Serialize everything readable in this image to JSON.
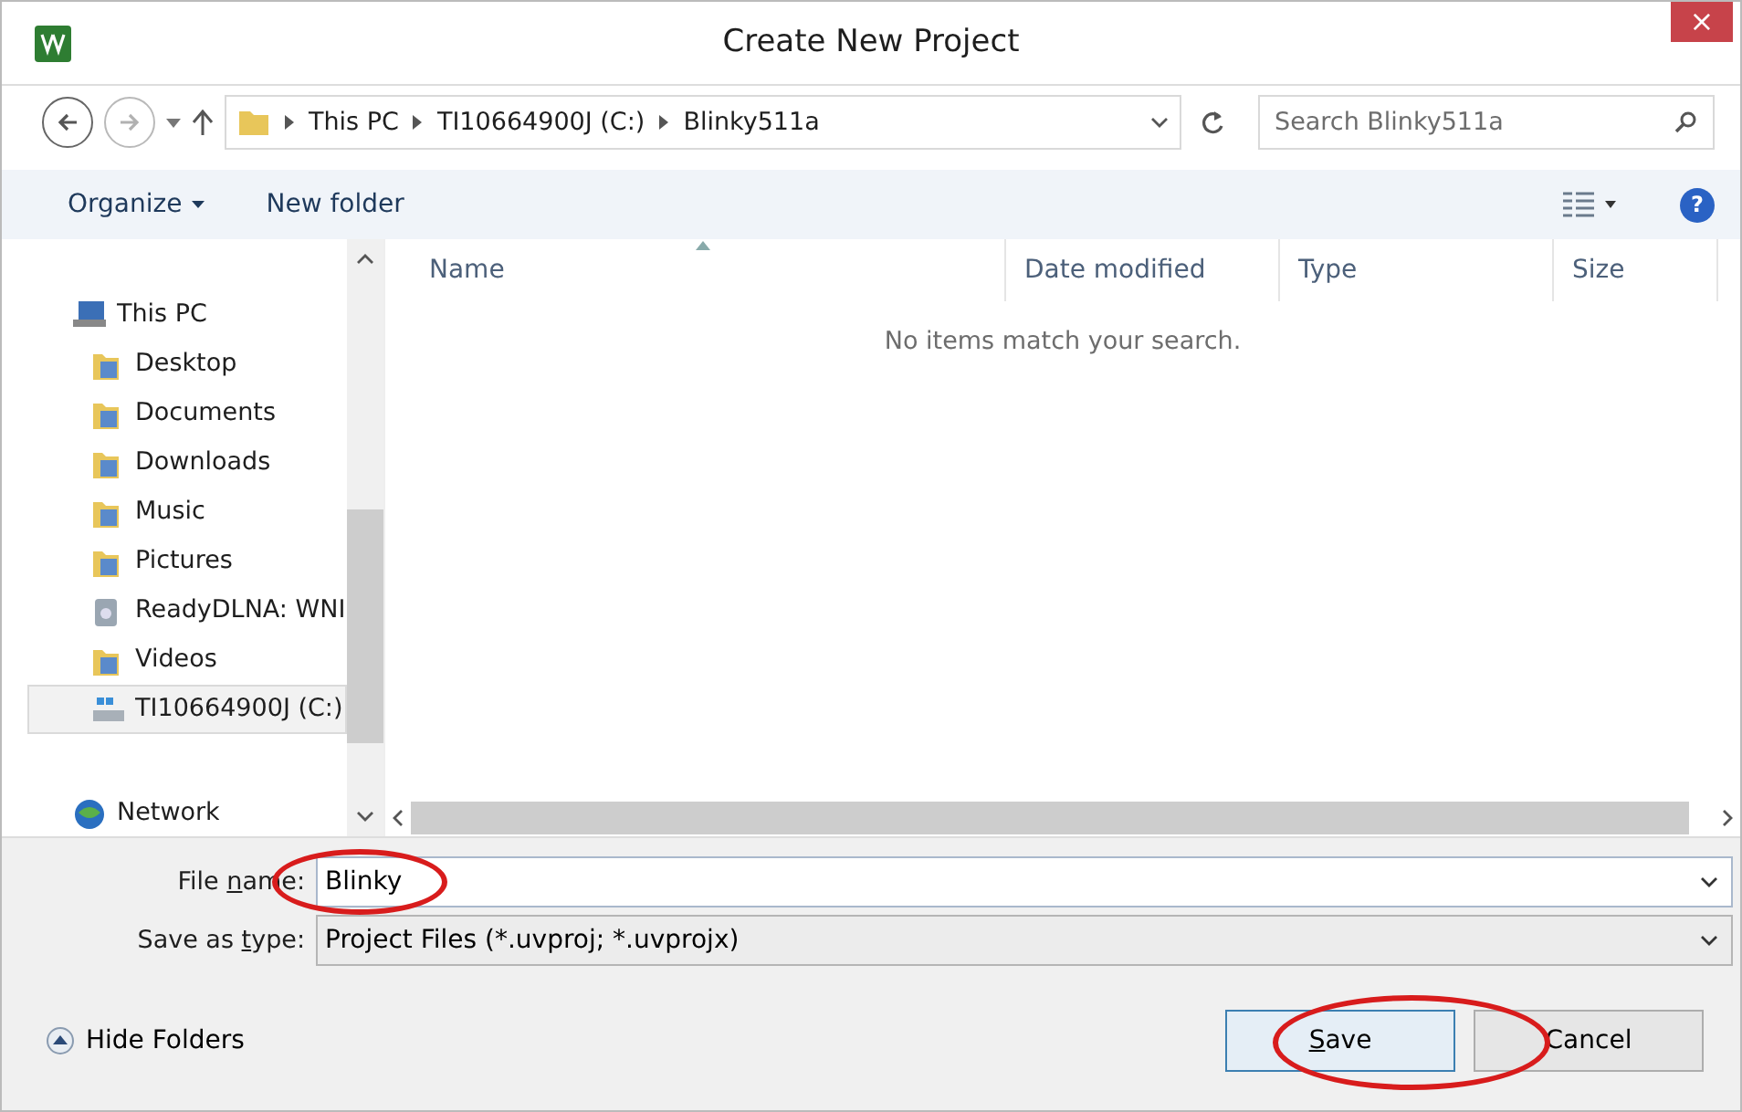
{
  "window": {
    "title": "Create New Project",
    "close": "×"
  },
  "address_bar": {
    "path": [
      "This PC",
      "TI10664900J (C:)",
      "Blinky511a"
    ],
    "search_placeholder": "Search Blinky511a"
  },
  "toolbar": {
    "organize": "Organize",
    "new_folder": "New folder",
    "help": "?"
  },
  "sidebar": {
    "items": [
      {
        "label": "This PC",
        "kind": "computer",
        "selected": false,
        "children": [
          {
            "label": "Desktop",
            "kind": "folder",
            "selected": false
          },
          {
            "label": "Documents",
            "kind": "folder",
            "selected": false
          },
          {
            "label": "Downloads",
            "kind": "folder",
            "selected": false
          },
          {
            "label": "Music",
            "kind": "folder",
            "selected": false
          },
          {
            "label": "Pictures",
            "kind": "folder",
            "selected": false
          },
          {
            "label": "ReadyDLNA: WNI",
            "kind": "device",
            "selected": false
          },
          {
            "label": "Videos",
            "kind": "folder",
            "selected": false
          },
          {
            "label": "TI10664900J (C:)",
            "kind": "drive",
            "selected": true
          }
        ]
      },
      {
        "label": "Network",
        "kind": "network",
        "selected": false
      }
    ]
  },
  "file_list": {
    "columns": [
      {
        "label": "Name",
        "sorted": true
      },
      {
        "label": "Date modified",
        "sorted": false
      },
      {
        "label": "Type",
        "sorted": false
      },
      {
        "label": "Size",
        "sorted": false
      }
    ],
    "empty_message": "No items match your search."
  },
  "form": {
    "fields": [
      {
        "label": [
          {
            "text": "File ",
            "underlined": false
          },
          {
            "text": "n",
            "underlined": true
          },
          {
            "text": "ame:",
            "underlined": false
          }
        ],
        "value": "Blinky",
        "editable": true,
        "circled": true
      },
      {
        "label": [
          {
            "text": "Save as ",
            "underlined": false
          },
          {
            "text": "t",
            "underlined": true
          },
          {
            "text": "ype:",
            "underlined": false
          }
        ],
        "value": "Project Files (*.uvproj; *.uvprojx)",
        "editable": false,
        "circled": false
      }
    ]
  },
  "hide_folders": "Hide Folders",
  "buttons": [
    {
      "label": [
        {
          "text": "S",
          "underlined": true
        },
        {
          "text": "ave",
          "underlined": false
        }
      ],
      "default": true,
      "circled": true
    },
    {
      "label": [
        {
          "text": "Cancel",
          "underlined": false
        }
      ],
      "default": false,
      "circled": false
    }
  ]
}
